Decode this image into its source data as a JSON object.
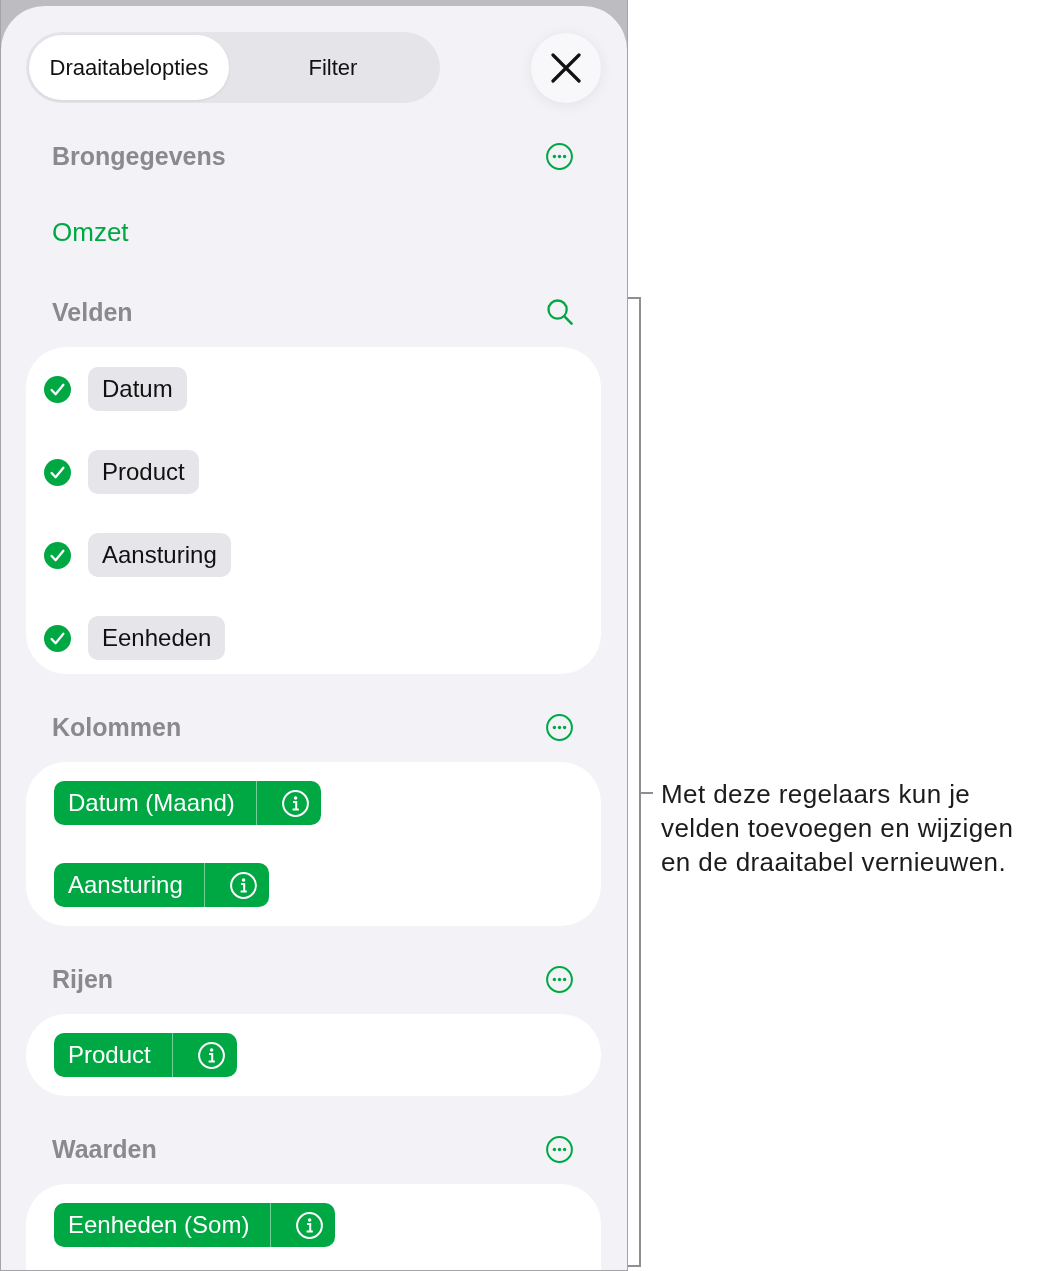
{
  "tabs": [
    {
      "label": "Draaitabelopties",
      "selected": true
    },
    {
      "label": "Filter",
      "selected": false
    }
  ],
  "sections": [
    {
      "kind": "source",
      "title": "Brongegevens",
      "value": "Omzet"
    },
    {
      "kind": "fields",
      "title": "Velden",
      "fields": [
        {
          "label": "Datum",
          "checked": true
        },
        {
          "label": "Product",
          "checked": true
        },
        {
          "label": "Aansturing",
          "checked": true
        },
        {
          "label": "Eenheden",
          "checked": true
        }
      ]
    },
    {
      "kind": "area",
      "title": "Kolommen",
      "items": [
        "Datum (Maand)",
        "Aansturing"
      ]
    },
    {
      "kind": "area",
      "title": "Rijen",
      "items": [
        "Product"
      ]
    },
    {
      "kind": "area",
      "title": "Waarden",
      "items": [
        "Eenheden (Som)"
      ]
    }
  ],
  "callout": {
    "text": "Met deze regelaars kun je velden toevoegen en wijzigen en de draaitabel vernieuwen."
  }
}
